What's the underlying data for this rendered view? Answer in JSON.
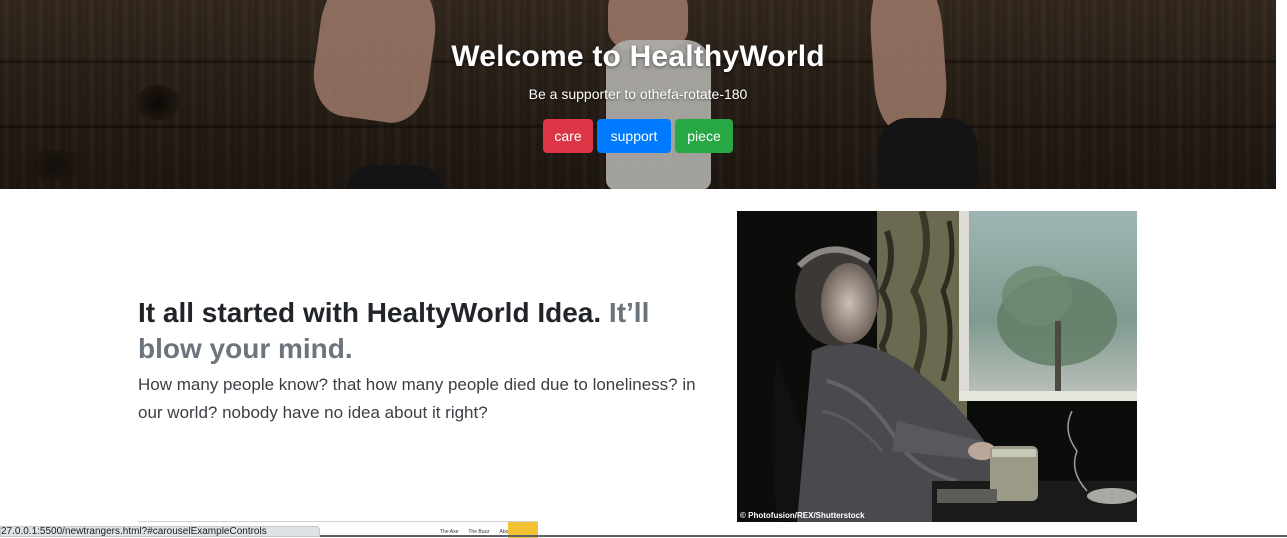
{
  "hero": {
    "title": "Welcome to HealthyWorld",
    "subtitle": "Be a supporter to othefa-rotate-180",
    "buttons": [
      {
        "label": "care",
        "color": "#dc3545"
      },
      {
        "label": "support",
        "color": "#007bff"
      },
      {
        "label": "piece",
        "color": "#28a745"
      }
    ]
  },
  "feature": {
    "heading_main": "It all started with HealtyWorld Idea.",
    "heading_muted": "It’ll blow your mind.",
    "lead": "How many people know? that how many people died due to loneliness? in our world? nobody have no idea about it right?",
    "image_credit": "© Photofusion/REX/Shutterstock"
  },
  "preview_strip": {
    "links": [
      "The Axe",
      "The Buzz",
      "About"
    ]
  },
  "status_bar": {
    "url": "27.0.0.1:5500/newtrangers.html?#carouselExampleControls"
  }
}
